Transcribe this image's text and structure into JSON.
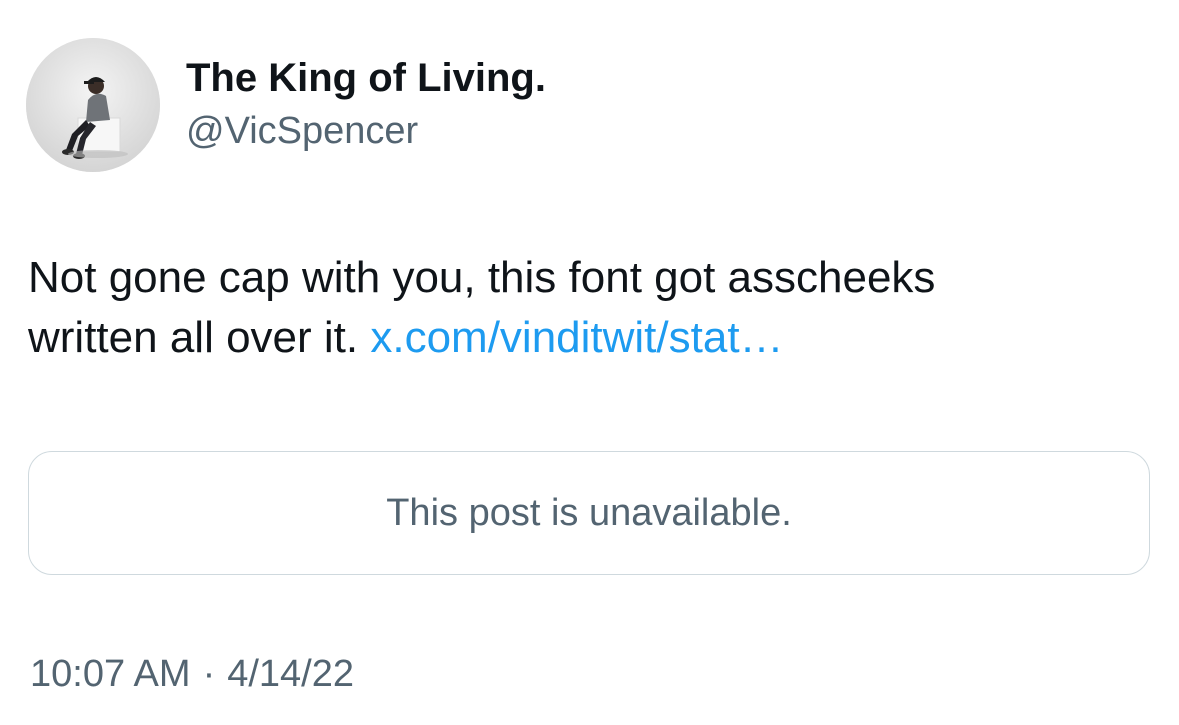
{
  "author": {
    "display_name": "The King of Living.",
    "handle": "@VicSpencer",
    "avatar_icon": "profile-photo-person-sitting-on-white-block"
  },
  "tweet": {
    "text_line1": "Not gone cap with you, this font got asscheeks",
    "text_line2_prefix": "written all over it.",
    "link_text": "x.com/vinditwit/stat…"
  },
  "quoted_post": {
    "message": "This post is unavailable."
  },
  "meta": {
    "time": "10:07 AM",
    "separator": "·",
    "date": "4/14/22"
  },
  "colors": {
    "text_primary": "#0f1419",
    "text_secondary": "#536471",
    "link": "#1d9bf0",
    "border": "#cfd9de",
    "background": "#ffffff"
  }
}
